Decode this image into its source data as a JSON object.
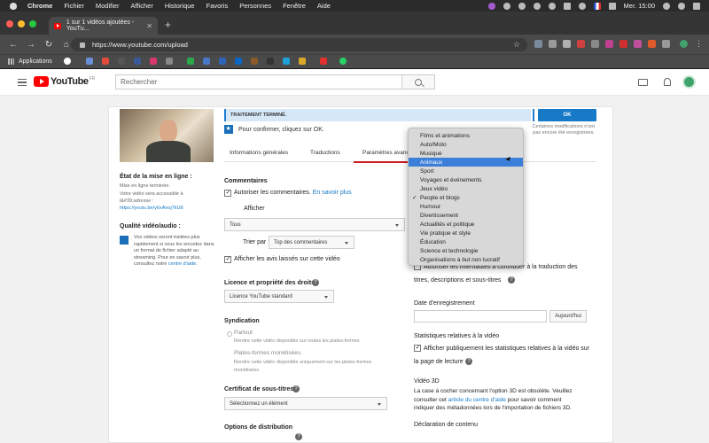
{
  "menubar": {
    "app": "Chrome",
    "items": [
      "Fichier",
      "Modifier",
      "Afficher",
      "Historique",
      "Favoris",
      "Personnes",
      "Fenêtre",
      "Aide"
    ],
    "clock": "Mer. 15:00"
  },
  "browser": {
    "tab_title": "1 sur 1 vidéos ajoutées - YouTu...",
    "url": "https://www.youtube.com/upload",
    "bookmarks_label": "Applications"
  },
  "youtube": {
    "logo": "YouTube",
    "logo_region": "FR",
    "search_placeholder": "Rechercher"
  },
  "upload": {
    "status": "TRAITEMENT TERMINÉ.",
    "ok_label": "OK",
    "save_note": "Certaines modifications n'ont pas encore été enregistrées.",
    "confirm_text": "Pour confirmer, cliquez sur OK.",
    "tabs": [
      "Informations générales",
      "Traductions",
      "Paramètres avancés"
    ],
    "left": {
      "state_title": "État de la mise en ligne :",
      "state_value": "Mise en ligne terminée.",
      "access_text": "Votre vidéo sera accessible à l&#39;adresse :",
      "url": "https://youtu.be/y6xAnoj7kU8",
      "quality_title": "Qualité vidéo/audio :",
      "quality_text": "Vos vidéos seront traitées plus rapidement si vous les encodez dans un format de fichier adapté au streaming. Pour en savoir plus, consultez notre",
      "quality_link": "centre d'aide",
      "quality_end": "."
    },
    "comments": {
      "title": "Commentaires",
      "allow": "Autoriser les commentaires.",
      "learn_more": "En savoir plus",
      "show_label": "Afficher",
      "show_value": "Tous",
      "sort_label": "Trier par",
      "sort_value": "Top des commentaires",
      "ratings": "Afficher les avis laissés sur cette vidéo"
    },
    "license": {
      "title": "Licence et propriété des droits",
      "value": "Licence YouTube standard"
    },
    "syndication": {
      "title": "Syndication",
      "everywhere": "Partout",
      "everywhere_desc": "Rendre cette vidéo disponible sur toutes les plates-formes",
      "monetized": "Plates-formes monétisées.",
      "monetized_desc": "Rendre cette vidéo disponible uniquement sur les plates-formes monétisées"
    },
    "subtitles": {
      "title": "Certificat de sous-titres",
      "value": "Sélectionnez un élément"
    },
    "distribution_title": "Options de distribution",
    "right": {
      "contrib_1": "Autoriser les internautes à contribuer à la traduction des",
      "contrib_2": "titres, descriptions et sous-titres",
      "date_title": "Date d'enregistrement",
      "today": "Aujourd'hui",
      "stats_title": "Statistiques relatives à la vidéo",
      "stats_1": "Afficher publiquement les statistiques relatives à la vidéo sur",
      "stats_2": "la page de lecture",
      "v3d_title": "Vidéo 3D",
      "v3d_1": "La case à cocher concernant l'option 3D est obsolète. Veuillez",
      "v3d_2a": "consulter cet",
      "v3d_link": "article du centre d'aide",
      "v3d_2b": "pour savoir comment",
      "v3d_3": "indiquer des métadonnées lors de l'importation de fichiers 3D.",
      "content_title": "Déclaration de contenu"
    },
    "categories": {
      "selected": "People et blogs",
      "highlighted": "Animaux",
      "items": [
        "Films et animations",
        "Auto/Moto",
        "Musique",
        "Animaux",
        "Sport",
        "Voyages et événements",
        "Jeux vidéo",
        "People et blogs",
        "Humour",
        "Divertissement",
        "Actualités et politique",
        "Vie pratique et style",
        "Éducation",
        "Science et technologie",
        "Organisations à but non lucratif"
      ]
    }
  },
  "colors": {
    "accent": "#167ac6",
    "youtube_red": "#ff0000",
    "highlight": "#3b7fd8"
  }
}
